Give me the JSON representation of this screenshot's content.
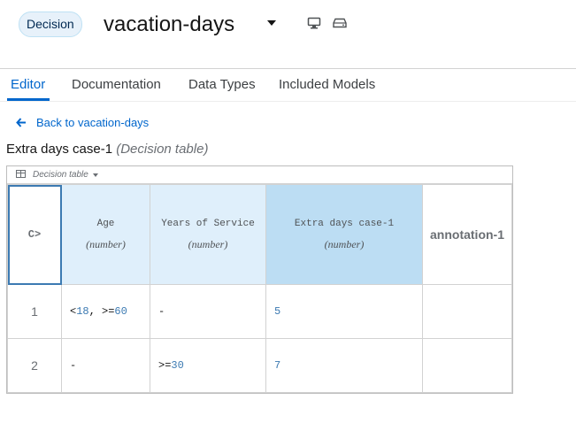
{
  "header": {
    "badge": "Decision",
    "title": "vacation-days",
    "icons": [
      "caret-down-icon",
      "monitor-icon",
      "hard-drive-icon"
    ]
  },
  "tabs": [
    {
      "label": "Editor",
      "active": true
    },
    {
      "label": "Documentation",
      "active": false
    },
    {
      "label": "Data Types",
      "active": false
    },
    {
      "label": "Included Models",
      "active": false
    }
  ],
  "back_link": "Back to vacation-days",
  "section": {
    "name": "Extra days case-1",
    "kind": "(Decision table)"
  },
  "decision_table": {
    "bar_label": "Decision table",
    "hit_policy": "C>",
    "columns": [
      {
        "name": "Age",
        "type": "(number)",
        "kind": "input"
      },
      {
        "name": "Years of Service",
        "type": "(number)",
        "kind": "input"
      },
      {
        "name": "Extra days case-1",
        "type": "(number)",
        "kind": "output"
      },
      {
        "name": "annotation-1",
        "kind": "annotation"
      }
    ],
    "rows": [
      {
        "num": "1",
        "age": [
          "<",
          "18",
          ", >=",
          "60"
        ],
        "years": "-",
        "extra": "5",
        "annotation": ""
      },
      {
        "num": "2",
        "age": [
          "-"
        ],
        "years_parts": [
          ">=",
          "30"
        ],
        "extra": "7",
        "annotation": ""
      }
    ]
  },
  "colors": {
    "accent": "#0066cc",
    "input_header": "#dfeffb",
    "output_header": "#bcddf3",
    "badge_bg": "#e7f1fa"
  }
}
